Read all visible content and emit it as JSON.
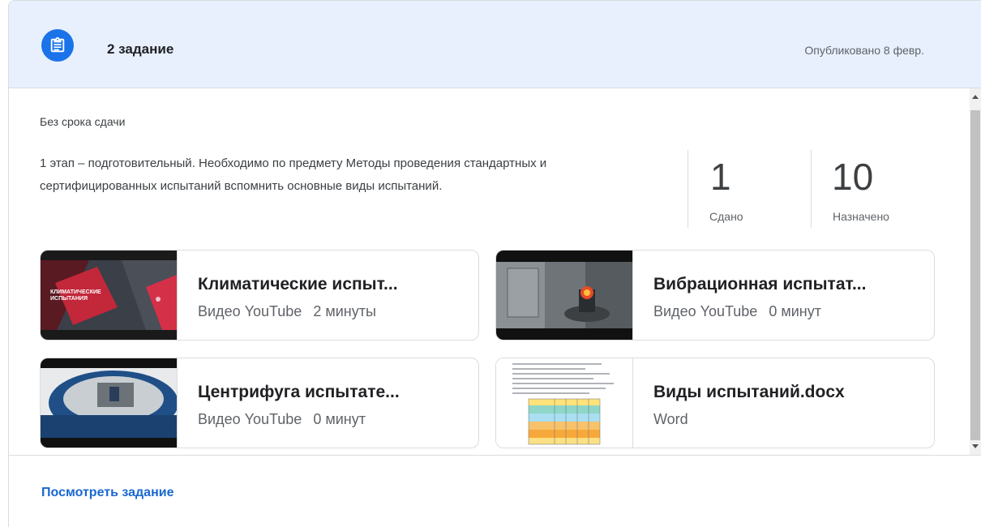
{
  "header": {
    "title": "2 задание",
    "published": "Опубликовано 8 февр.",
    "icon": "assignment-icon",
    "accent": "#1a73e8",
    "background": "#e8f0fe"
  },
  "due": "Без срока сдачи",
  "description": "1 этап – подготовительный. Необходимо по предмету Методы проведения стандартных и сертифицированных испытаний вспомнить основные виды испытаний.",
  "stats": {
    "turned_in": {
      "value": "1",
      "label": "Сдано"
    },
    "assigned": {
      "value": "10",
      "label": "Назначено"
    }
  },
  "attachments": [
    {
      "title": "Климатические испыт...",
      "type": "Видео YouTube",
      "duration": "2 минуты",
      "thumb_text_1": "КЛИМАТИЧЕСКИЕ",
      "thumb_text_2": "ИСПЫТАНИЯ"
    },
    {
      "title": "Вибрационная испытат...",
      "type": "Видео YouTube",
      "duration": "0 минут"
    },
    {
      "title": "Центрифуга испытате...",
      "type": "Видео YouTube",
      "duration": "0 минут"
    },
    {
      "title": "Виды испытаний.docx",
      "type": "Word",
      "duration": ""
    }
  ],
  "footer": {
    "link": "Посмотреть задание",
    "link_color": "#1967d2"
  }
}
